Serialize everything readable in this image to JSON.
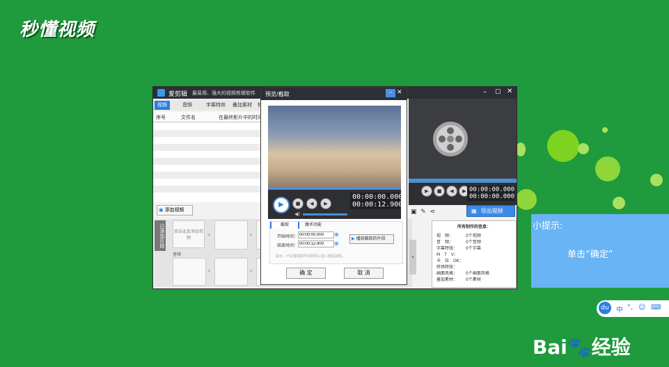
{
  "watermark": {
    "logo_text": "秒懂视频"
  },
  "app": {
    "title": "爱剪辑",
    "subtitle": "最易用、强大的视频剪辑软件",
    "tabs": [
      "视频",
      "音频",
      "字幕特效",
      "叠加素材",
      "转"
    ],
    "list_headers": [
      "序号",
      "文件名",
      "在最终影片中的时间"
    ],
    "add_video_label": "添加视频",
    "side_label": "已添加片段",
    "clip_placeholder": "双击此处添加视频",
    "audio_label": "音频",
    "right_times": {
      "t1": "00:00:00.000",
      "t2": "00:00:00.000"
    },
    "export_label": "导出视频",
    "info_title": "所有制作的信息：",
    "info_rows": [
      {
        "k": "视　频：",
        "v": "0个视频"
      },
      {
        "k": "音　频：",
        "v": "0个音频"
      },
      {
        "k": "字幕特效：",
        "v": "0个字幕"
      },
      {
        "k": "M　T　V：",
        "v": ""
      },
      {
        "k": "卡　拉　OK：",
        "v": ""
      },
      {
        "k": "转场特效：",
        "v": ""
      },
      {
        "k": "画面风格：",
        "v": "0个画面风格"
      },
      {
        "k": "叠加素材：",
        "v": "0个素材"
      }
    ]
  },
  "dialog": {
    "title": "预览/截取",
    "time_current": "00:00:00.000",
    "time_total": "00:00:12.900",
    "tab_cut": "截取",
    "tab_magic": "魔术功能",
    "start_label": "开始时间：",
    "start_value": "00:00:00.000",
    "end_label": "结束时间：",
    "end_value": "00:00:12.900",
    "play_clip_label": "播放截取的片段",
    "hint": "提示：不设置截取时间即默认插入整段视频。",
    "ok_label": "确 定",
    "cancel_label": "取 消"
  },
  "tip": {
    "title": "小提示:",
    "body": "单击“确定”"
  },
  "baidu_bar": {
    "items": [
      "du",
      "中",
      "°,",
      "☺",
      "⌨"
    ]
  },
  "baidu_logo": {
    "text": "Bai",
    "paw": "🐾",
    "suffix": "经验"
  }
}
